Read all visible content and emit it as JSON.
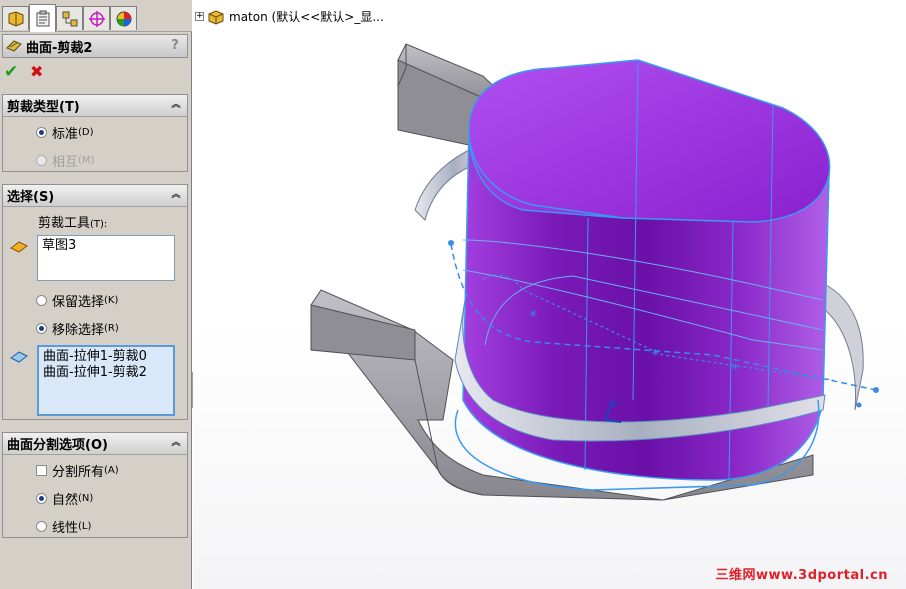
{
  "feature": {
    "title": "曲面-剪裁2",
    "help": "?",
    "ok": "✔",
    "cancel": "✖"
  },
  "tabs": [
    "feature-manager",
    "property-manager",
    "configuration-manager",
    "dimxpert-manager",
    "display-manager"
  ],
  "trim_type": {
    "header": "剪裁类型(T)",
    "options": [
      {
        "label": "标准",
        "key": "(D)",
        "selected": true,
        "enabled": true
      },
      {
        "label": "相互",
        "key": "(M)",
        "selected": false,
        "enabled": false
      }
    ]
  },
  "selection": {
    "header": "选择(S)",
    "trim_tool_label": "剪裁工具",
    "trim_tool_key": "(T):",
    "trim_tool_value": "草图3",
    "keep_label": "保留选择",
    "keep_key": "(K)",
    "remove_label": "移除选择",
    "remove_key": "(R)",
    "faces": [
      "曲面-拉伸1-剪裁0",
      "曲面-拉伸1-剪裁2"
    ]
  },
  "split_options": {
    "header": "曲面分割选项(O)",
    "split_all_label": "分割所有",
    "split_all_key": "(A)",
    "natural_label": "自然",
    "natural_key": "(N)",
    "linear_label": "线性",
    "linear_key": "(L)"
  },
  "tree": {
    "root_label": "maton  (默认<<默认>_显..."
  },
  "watermark": "三维网www.3dportal.cn",
  "colors": {
    "surface_purple": "#8a2ac8",
    "surface_grey": "#9a9aa0",
    "edge_blue": "#3a9af0",
    "panel_bg": "#d4d0c8"
  }
}
